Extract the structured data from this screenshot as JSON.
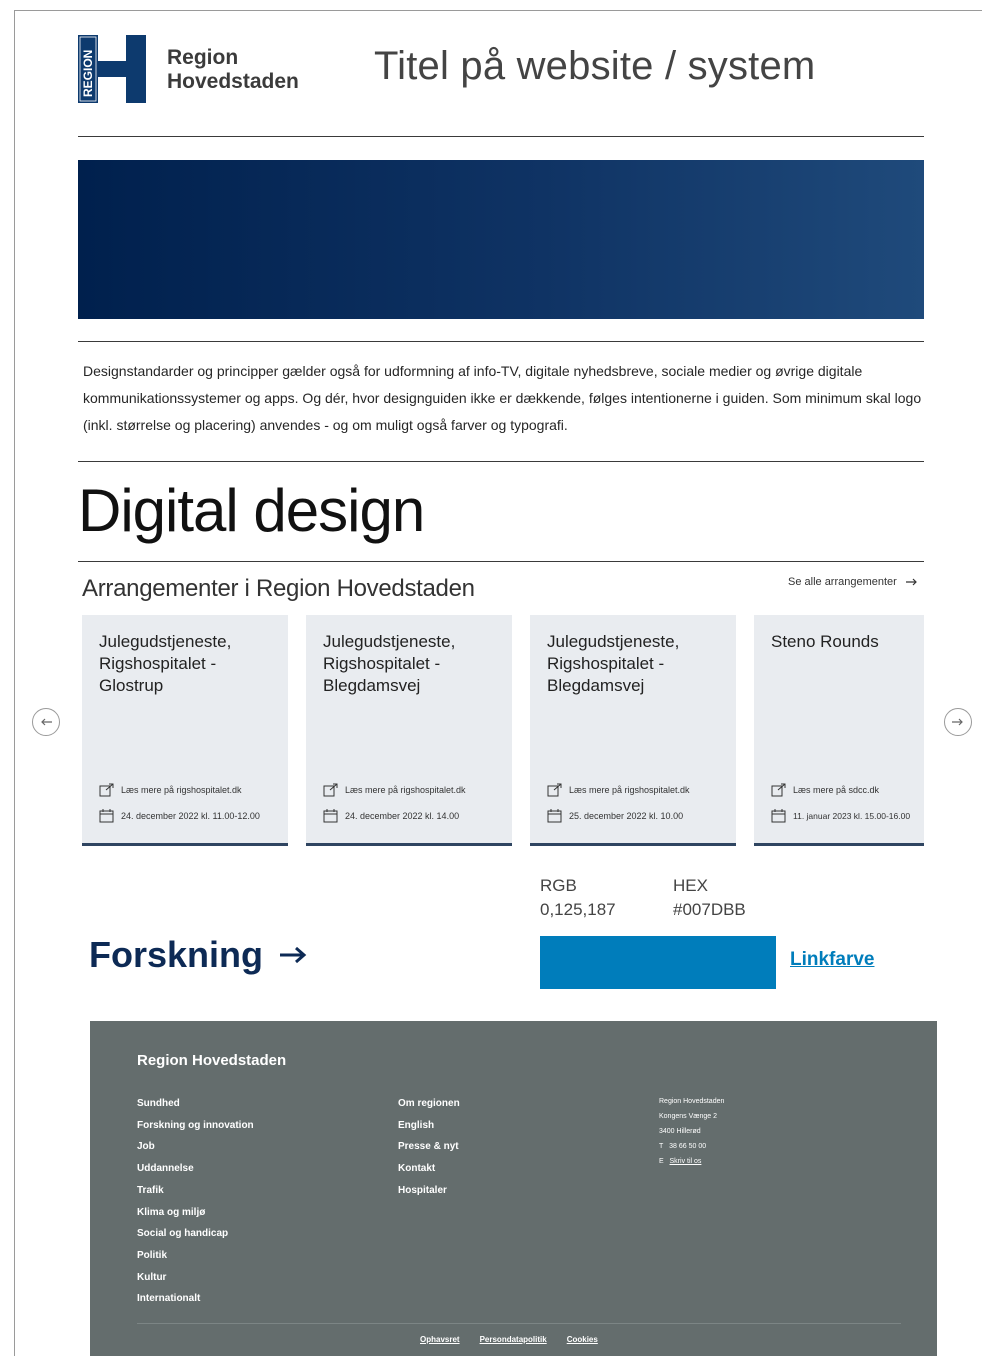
{
  "header": {
    "logo_vertical": "REGION",
    "logo_line1": "Region",
    "logo_line2": "Hovedstaden",
    "site_title": "Titel på website / system"
  },
  "intro": {
    "text": "Designstandarder og principper gælder også for udformning af info-TV, digitale nyhedsbreve, sociale medier og øvrige digitale kommunikationssystemer og apps. Og dér, hvor designguiden ikke er dækkende, følges intentionerne i guiden. Som minimum skal logo (inkl. størrelse og placering) anvendes - og om muligt også farver og typografi."
  },
  "page_heading": "Digital design",
  "events": {
    "title": "Arrangementer i Region Hovedstaden",
    "see_all": "Se alle arrangementer",
    "cards": [
      {
        "title": "Julegudstjeneste, Rigshospitalet - Glostrup",
        "link": "Læs mere på rigshospitalet.dk",
        "date": "24. december 2022 kl. 11.00-12.00"
      },
      {
        "title": "Julegudstjeneste, Rigshospitalet - Blegdamsvej",
        "link": "Læs mere på rigshospitalet.dk",
        "date": "24. december 2022 kl. 14.00"
      },
      {
        "title": "Julegudstjeneste, Rigshospitalet - Blegdamsvej",
        "link": "Læs mere på rigshospitalet.dk",
        "date": "25. december 2022 kl. 10.00"
      },
      {
        "title": "Steno Rounds",
        "link": "Læs mere på sdcc.dk",
        "date": "11. januar 2023 kl. 15.00-16.00"
      }
    ]
  },
  "color_spec": {
    "rgb_label": "RGB",
    "rgb_value": "0,125,187",
    "hex_label": "HEX",
    "hex_value": "#007DBB",
    "swatch_color": "#007DBB",
    "link_label": "Linkfarve"
  },
  "forskning_link": "Forskning",
  "footer": {
    "brand": "Region Hovedstaden",
    "col1": [
      "Sundhed",
      "Forskning og innovation",
      "Job",
      "Uddannelse",
      "Trafik",
      "Klima og miljø",
      "Social og handicap",
      "Politik",
      "Kultur",
      "Internationalt"
    ],
    "col2": [
      "Om regionen",
      "English",
      "Presse & nyt",
      "Kontakt",
      "Hospitaler"
    ],
    "address": {
      "name": "Region Hovedstaden",
      "street": "Kongens Vænge 2",
      "city": "3400 Hillerød",
      "phone_label": "T",
      "phone": "38 66 50 00",
      "email_label": "E",
      "email": "Skriv til os"
    },
    "legal": [
      "Ophavsret",
      "Persondatapolitik",
      "Cookies"
    ]
  },
  "colors": {
    "hero_dark": "#00204d",
    "hero_light": "#1f4a7b",
    "footer_bg": "#646d6d",
    "brand_navy": "#0d2a55",
    "link_blue": "#007DBB"
  }
}
